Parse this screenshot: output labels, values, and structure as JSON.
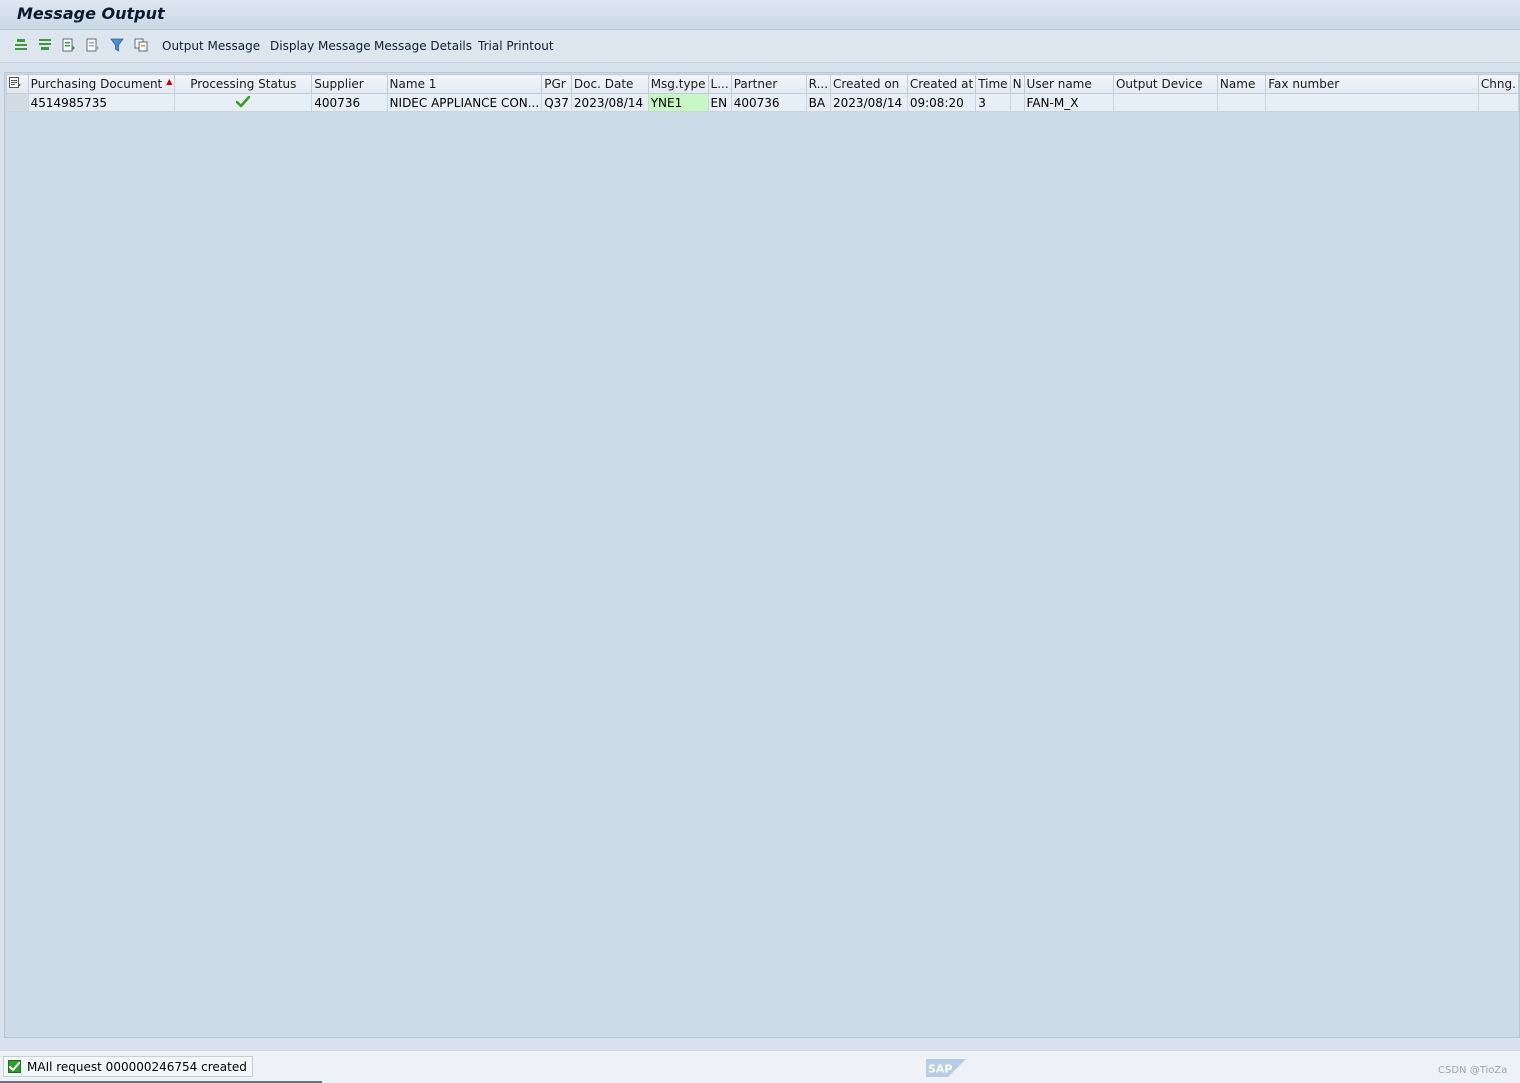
{
  "title": "Message Output",
  "toolbar": {
    "icons": [
      "expand-all-icon",
      "collapse-all-icon",
      "select-block-icon",
      "deselect-icon",
      "filter-icon",
      "copy-icon"
    ],
    "output_message": "Output Message",
    "display_message": "Display Message",
    "message_details": "Message Details",
    "trial_printout": "Trial Printout"
  },
  "table": {
    "columns": [
      "Purchasing Document",
      "Processing Status",
      "Supplier",
      "Name 1",
      "PGr",
      "Doc. Date",
      "Msg.type",
      "L...",
      "Partner",
      "R...",
      "Created on",
      "Created at",
      "Time",
      "N",
      "User name",
      "Output Device",
      "Name",
      "Fax number",
      "Chng."
    ],
    "rows": [
      {
        "purchasing_document": "4514985735",
        "processing_status": "✔",
        "supplier": "400736",
        "name1": "NIDEC APPLIANCE CON...",
        "pgr": "Q37",
        "doc_date": "2023/08/14",
        "msg_type": "YNE1",
        "lang": "EN",
        "partner": "400736",
        "role": "BA",
        "created_on": "2023/08/14",
        "created_at": "09:08:20",
        "time": "3",
        "n": "",
        "user_name": "FAN-M_X",
        "output_device": "",
        "name": "",
        "fax_number": "",
        "chng": ""
      }
    ]
  },
  "status": {
    "message": "MAIl request 000000246754 created",
    "watermark": "CSDN @TioZa",
    "logo": "SAP"
  },
  "colors": {
    "background": "#cddbe8",
    "highlight": "#c7f7c2",
    "success": "#2e9b2e",
    "sort_indicator": "#c00000"
  }
}
